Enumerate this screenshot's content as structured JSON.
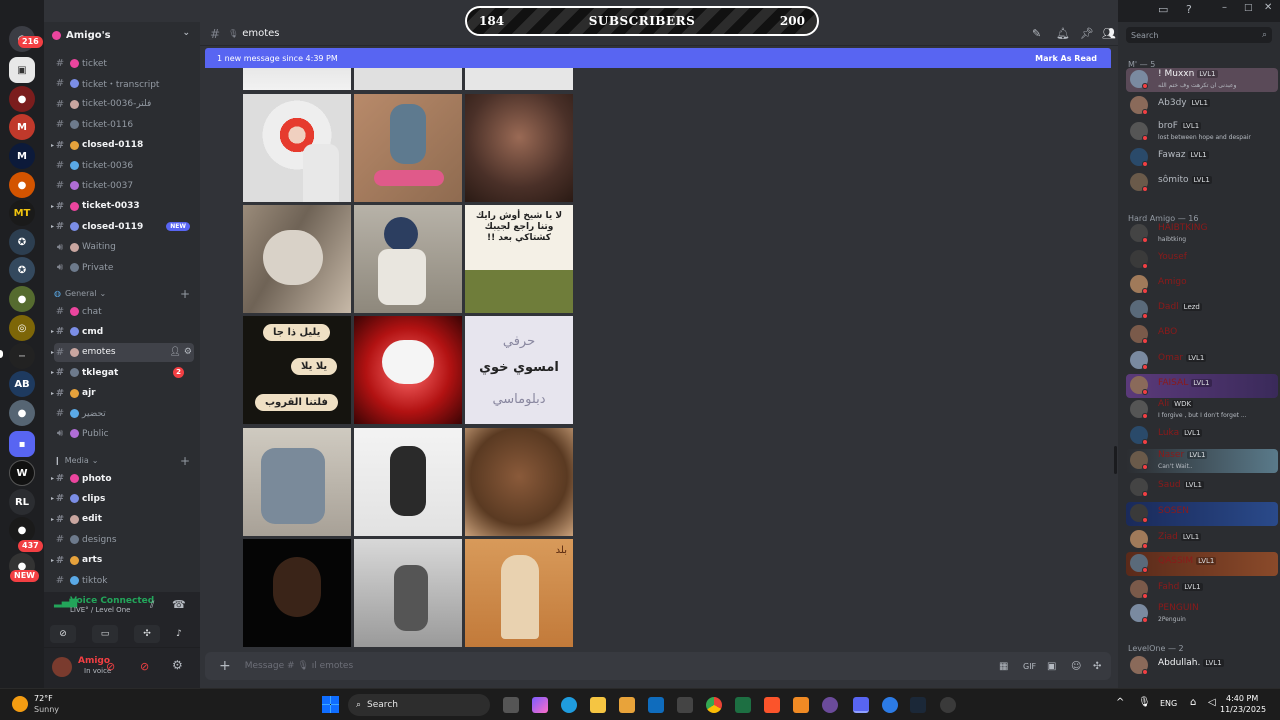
{
  "rail": {
    "badges": [
      "216",
      "437",
      "NEW"
    ],
    "labels": [
      "RL"
    ]
  },
  "server": {
    "name": "Amigo's"
  },
  "channels": [
    {
      "name": "ticket",
      "style": "normal"
    },
    {
      "name": "ticket・transcript",
      "style": "normal"
    },
    {
      "name": "ticket-0036-فلتر",
      "style": "normal"
    },
    {
      "name": "ticket-0116",
      "style": "normal"
    },
    {
      "name": "closed-0118",
      "style": "bold"
    },
    {
      "name": "ticket-0036",
      "style": "normal"
    },
    {
      "name": "ticket-0037",
      "style": "normal"
    },
    {
      "name": "ticket-0033",
      "style": "bold"
    },
    {
      "name": "closed-0119",
      "style": "bold",
      "badge": "NEW"
    },
    {
      "name": "Waiting",
      "style": "voice"
    },
    {
      "name": "Private",
      "style": "voice"
    }
  ],
  "categories": {
    "general": "General",
    "media": "Media"
  },
  "general_channels": [
    {
      "name": "chat",
      "style": "normal"
    },
    {
      "name": "cmd",
      "style": "bold"
    },
    {
      "name": "emotes",
      "style": "selected"
    },
    {
      "name": "tklegat",
      "style": "bold",
      "count": "2"
    },
    {
      "name": "ajr",
      "style": "bold"
    },
    {
      "name": "تحضير",
      "style": "normal"
    },
    {
      "name": "Public",
      "style": "voice"
    }
  ],
  "media_channels": [
    {
      "name": "photo",
      "style": "bold"
    },
    {
      "name": "clips",
      "style": "bold"
    },
    {
      "name": "edit",
      "style": "bold"
    },
    {
      "name": "designs",
      "style": "normal"
    },
    {
      "name": "arts",
      "style": "bold"
    },
    {
      "name": "tiktok",
      "style": "normal"
    }
  ],
  "voice": {
    "title": "Voice Connected",
    "sub": "LIVE° / Level One"
  },
  "user": {
    "name": "Amigo",
    "status": "In voice"
  },
  "topbar": {
    "channel": "emotes"
  },
  "new_messages": {
    "text": "1 new message since 4:39 PM",
    "mark_read": "Mark As Read"
  },
  "composer": {
    "placeholder": "Message # 🎙 ıl emotes"
  },
  "stream_overlay": {
    "left": "184",
    "center": "SUBSCRIBERS",
    "right": "200"
  },
  "tile_text": {
    "t6": "لا يا شيخ أوش رايك وتنا راجع لجيبك كشتاكي بعد !!",
    "t7a": "يليل ذا جا",
    "t7b": "يلا يلا",
    "t7c": "فلتنا القروب",
    "t9a": "حرفي",
    "t9b": "امسوي خوي",
    "t9c": "دبلوماسي",
    "t15": "بلد"
  },
  "members": {
    "search": "Search",
    "groups": [
      "M' — 5",
      "Hard Amigo — 16",
      "LevelOne — 2"
    ],
    "list": [
      {
        "name": "! Muxxn",
        "lvl": "LVL1",
        "status": "وعبدنی ان تکرهت وف ختم الله"
      },
      {
        "name": "Ab3dy",
        "lvl": "LVL1"
      },
      {
        "name": "broF",
        "lvl": "LVL1",
        "status": "lost between hope and despair"
      },
      {
        "name": "Fawaz",
        "lvl": "LVL1"
      },
      {
        "name": "sômito",
        "lvl": "LVL1"
      },
      {
        "name": "HAIBTKING",
        "status": "haibtking"
      },
      {
        "name": "Yousef"
      },
      {
        "name": "Amigo"
      },
      {
        "name": "Dadl",
        "lvl": "Lezd"
      },
      {
        "name": "ABO"
      },
      {
        "name": "Omar",
        "lvl": "LVL1"
      },
      {
        "name": "FAISAL",
        "lvl": "LVL1"
      },
      {
        "name": "Ali",
        "lvl": "WDK",
        "status": "I forgive , but I don't forget ..."
      },
      {
        "name": "Luka",
        "lvl": "LVL1"
      },
      {
        "name": "Naser",
        "lvl": "LVL1",
        "status": "Can't Wait.."
      },
      {
        "name": "Saud",
        "lvl": "LVL1"
      },
      {
        "name": "SOSEN"
      },
      {
        "name": "Ziad",
        "lvl": "LVL1"
      },
      {
        "name": "QASSIM",
        "lvl": "LVL1"
      },
      {
        "name": "Fahd",
        "lvl": "LVL1"
      },
      {
        "name": "PENGUIN",
        "status": "2Penguin"
      },
      {
        "name": "Abdullah.",
        "lvl": "LVL1"
      }
    ]
  },
  "taskbar": {
    "weather_temp": "72°F",
    "weather_desc": "Sunny",
    "search": "Search",
    "lang": "ENG",
    "time": "4:40 PM",
    "date": "11/23/2025"
  }
}
